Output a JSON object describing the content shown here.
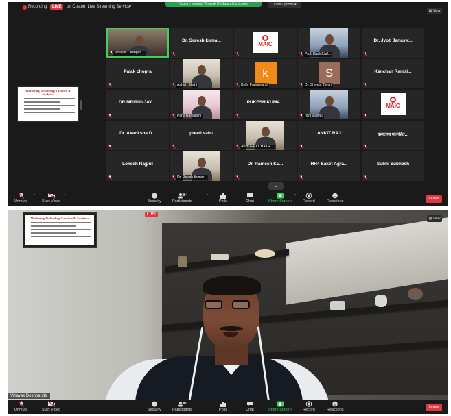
{
  "meeting": {
    "recording_label": "Recording",
    "live_badge": "LIVE",
    "live_text": "on Custom Live Streaming Service",
    "banner_text": "You are viewing Vinayak Deshpande's screen",
    "view_options": "View Options",
    "view_button": "View"
  },
  "share": {
    "slide_title": "Marketing Technology Creative & Analytics"
  },
  "gallery": {
    "tiles": [
      {
        "name": "Vinayak Deshpan...",
        "kind": "video",
        "label_pos": "tag",
        "active": true
      },
      {
        "name": "Dr. Suresh kuma...",
        "kind": "name"
      },
      {
        "name": "",
        "kind": "logo",
        "logo_text": "MAIC"
      },
      {
        "name": "Prof. Kashif Jaf...",
        "kind": "video",
        "label_pos": "tag",
        "video_style": "blue"
      },
      {
        "name": "Dr. Jyoti Janasw...",
        "kind": "name"
      },
      {
        "name": "Palak chopra",
        "kind": "name"
      },
      {
        "name": "Ashish Shahi",
        "kind": "video",
        "label_pos": "tag",
        "video_style": "light"
      },
      {
        "name": "Kethi Parmanand",
        "kind": "avatar",
        "avatar": "k",
        "label_pos": "tag"
      },
      {
        "name": "Dr. Shweta Tiwari",
        "kind": "avatar",
        "avatar": "S",
        "label_pos": "tag"
      },
      {
        "name": "Kanchan Ramsi...",
        "kind": "name"
      },
      {
        "name": "DR.MRITUNJAY....",
        "kind": "name"
      },
      {
        "name": "Parul Rajvanshi",
        "kind": "video",
        "label_pos": "tag",
        "video_style": "pink"
      },
      {
        "name": "PUKESH  KUMA...",
        "kind": "name"
      },
      {
        "name": "rishi jaiswal",
        "kind": "video",
        "label_pos": "tag",
        "video_style": "blue"
      },
      {
        "name": "",
        "kind": "logo",
        "logo_text": "MAIC"
      },
      {
        "name": "Dr. Akanksha D...",
        "kind": "name"
      },
      {
        "name": "preeti sahu",
        "kind": "name"
      },
      {
        "name": "ABHIJEET CHAKR...",
        "kind": "video",
        "label_pos": "tag",
        "video_style": "light"
      },
      {
        "name": "ANKIT RAJ",
        "kind": "name"
      },
      {
        "name": "कमलाथ मलकीत...",
        "kind": "name"
      },
      {
        "name": "Lokesh Rajput",
        "kind": "name"
      },
      {
        "name": "Dr. Ravish Kumar...",
        "kind": "video",
        "label_pos": "tag",
        "video_style": "light"
      },
      {
        "name": "Dr. Ramesh Ku...",
        "kind": "name"
      },
      {
        "name": "HH4  Saket Agra...",
        "kind": "name"
      },
      {
        "name": "Subhi Subhash",
        "kind": "name"
      }
    ]
  },
  "toolbar1": {
    "unmute": "Unmute",
    "start_video": "Start Video",
    "security": "Security",
    "participants": "Participants",
    "participants_count": "184",
    "polls": "Polls",
    "chat": "Chat",
    "share_screen": "Share Screen",
    "record": "Record",
    "reactions": "Reactions",
    "leave": "Leave"
  },
  "toolbar2": {
    "unmute": "Unmute",
    "start_video": "Start Video",
    "security": "Security",
    "participants": "Participants",
    "participants_count": "190",
    "polls": "Polls",
    "chat": "Chat",
    "share_screen": "Share Screen",
    "record": "Record",
    "reactions": "Reactions",
    "leave": "Leave"
  },
  "speaker": {
    "name": "Vinayak Deshpande",
    "view_button": "View"
  },
  "colors": {
    "active_border": "#3bd15a",
    "leave": "#e0383e",
    "live": "#e0383e",
    "share_green": "#3bd15a"
  }
}
